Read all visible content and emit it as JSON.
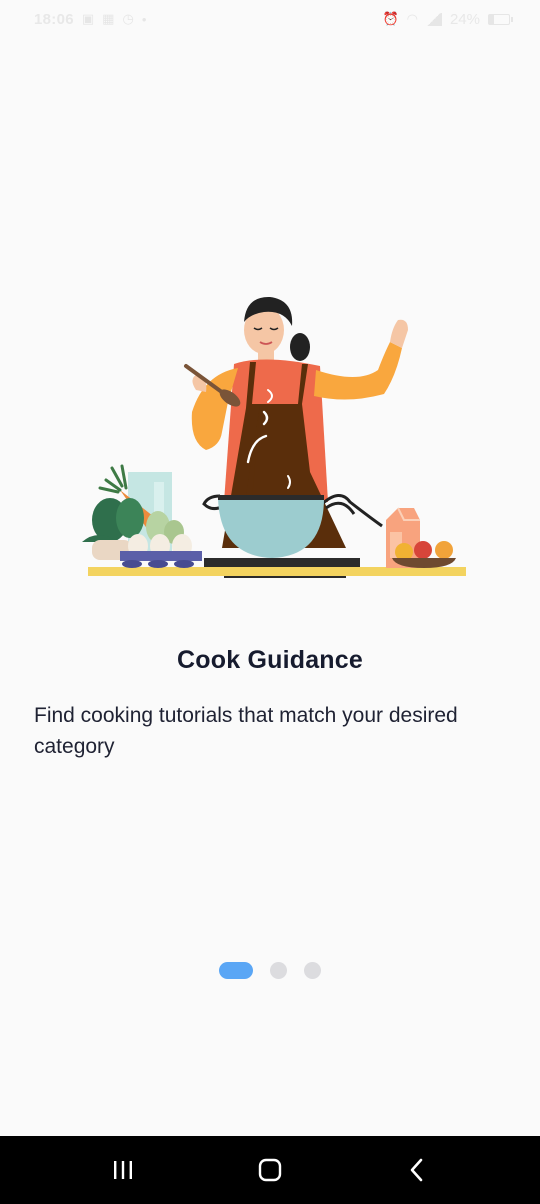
{
  "status_bar": {
    "time": "18:06",
    "battery": "24%",
    "icons": [
      "image-icon",
      "calendar-icon",
      "clock-icon",
      "dot-icon",
      "alarm-icon",
      "wifi-icon",
      "signal-icon",
      "battery-icon"
    ]
  },
  "onboarding": {
    "title": "Cook Guidance",
    "description": "Find cooking tutorials that match your desired category",
    "page_index": 1,
    "page_count": 3
  },
  "colors": {
    "accent": "#5aa6f5",
    "dot_inactive": "#dcdcdf",
    "title": "#161b2e",
    "apron": "#5a2e0b",
    "sleeve": "#f9a73e",
    "pot": "#9ccccf"
  },
  "nav_bar": {
    "recent_icon": "recent-apps-icon",
    "home_icon": "home-icon",
    "back_icon": "back-icon"
  }
}
